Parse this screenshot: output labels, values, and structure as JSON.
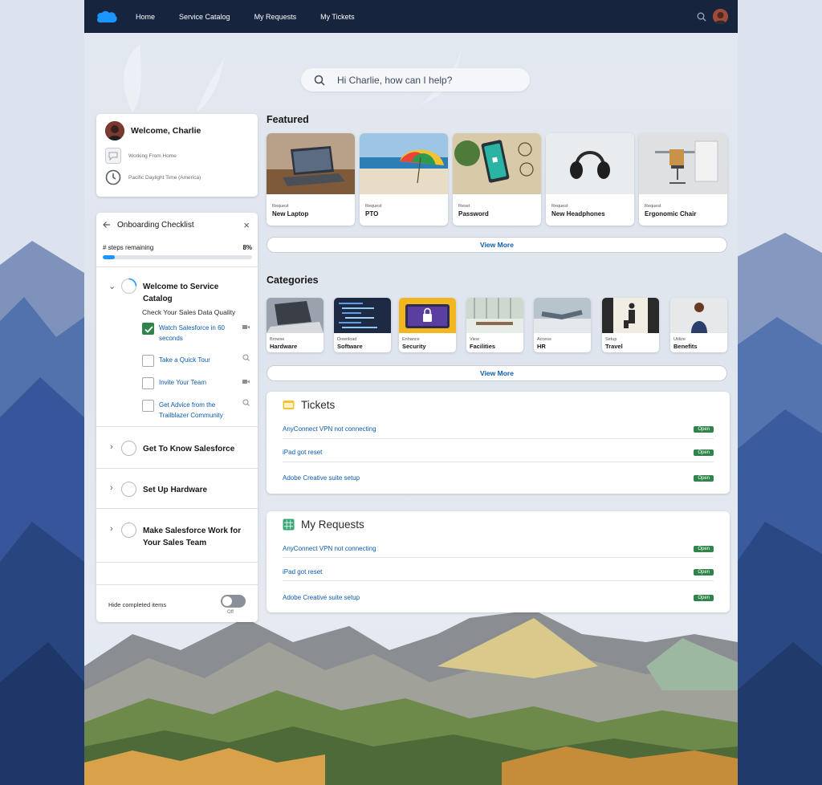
{
  "nav": {
    "links": [
      "Home",
      "Service Catalog",
      "My Requests",
      "My Tickets"
    ]
  },
  "search": {
    "placeholder": "Hi Charlie, how can I help?"
  },
  "welcome": {
    "greeting": "Welcome, Charlie",
    "status": "Working From Home",
    "timezone": "Pacific Daylight Time (America)"
  },
  "checklist": {
    "title": "Onboarding Checklist",
    "steps_label": "# steps remaining",
    "progress_label": "8%",
    "progress_fraction": 0.08,
    "section1": {
      "title": "Welcome to Service Catalog",
      "subtitle": "Check Your Sales Data Quality",
      "tasks": [
        {
          "label": "Watch Salesforce in 60 seconds",
          "done": true,
          "icon": "video-icon"
        },
        {
          "label": "Take a Quick Tour",
          "done": false,
          "icon": "guide-icon"
        },
        {
          "label": "Invite Your Team",
          "done": false,
          "icon": "video-icon"
        },
        {
          "label": "Get Advice from the Trailblazer Community",
          "done": false,
          "icon": "guide-icon"
        }
      ]
    },
    "sections": [
      "Get To Know Salesforce",
      "Set Up Hardware",
      "Make Salesforce Work for Your Sales Team"
    ],
    "hide_completed": "Hide completed items",
    "toggle_state": "Off"
  },
  "featured": {
    "title": "Featured",
    "items": [
      {
        "kind": "Request",
        "name": "New Laptop"
      },
      {
        "kind": "Request",
        "name": "PTO"
      },
      {
        "kind": "Reset",
        "name": "Password"
      },
      {
        "kind": "Request",
        "name": "New Headphones"
      },
      {
        "kind": "Request",
        "name": "Ergonomic Chair"
      }
    ],
    "view_more": "View More"
  },
  "categories": {
    "title": "Categories",
    "items": [
      {
        "kind": "Browse",
        "name": "Hardware"
      },
      {
        "kind": "Download",
        "name": "Software"
      },
      {
        "kind": "Enhance",
        "name": "Security"
      },
      {
        "kind": "View",
        "name": "Facilities"
      },
      {
        "kind": "Access",
        "name": "HR"
      },
      {
        "kind": "Setup",
        "name": "Travel"
      },
      {
        "kind": "Utilize",
        "name": "Benefits"
      }
    ],
    "view_more": "View More"
  },
  "tickets": {
    "title": "Tickets",
    "rows": [
      {
        "title": "AnyConnect VPN not connecting",
        "status": "Open"
      },
      {
        "title": "iPad got reset",
        "status": "Open"
      },
      {
        "title": "Adobe Creative suite setup",
        "status": "Open"
      }
    ]
  },
  "requests": {
    "title": "My Requests",
    "rows": [
      {
        "title": "AnyConnect VPN not connecting",
        "status": "Open"
      },
      {
        "title": "iPad got reset",
        "status": "Open"
      },
      {
        "title": "Adobe Creative suite setup",
        "status": "Open"
      }
    ]
  },
  "colors": {
    "nav": "#16243e",
    "link": "#0b5cab",
    "open_badge": "#2e844a",
    "progress": "#1b96ff"
  }
}
